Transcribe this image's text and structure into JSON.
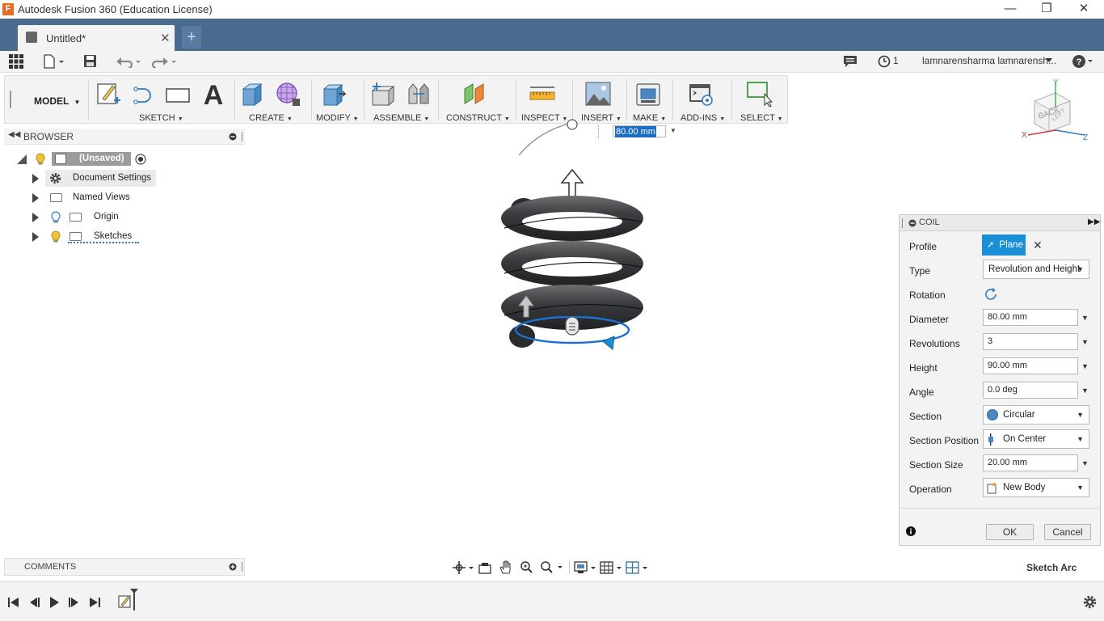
{
  "window": {
    "title": "Autodesk Fusion 360 (Education License)",
    "logo_letter": "F",
    "minimize": "—",
    "maximize": "❐",
    "close": "✕"
  },
  "tabs": [
    {
      "title": "Untitled*",
      "close": "✕"
    }
  ],
  "new_tab": "+",
  "quickbar": {
    "job_count": "1",
    "user": "lamnarensharma lamnarensh...",
    "help": "?"
  },
  "toolbar": {
    "workspace": "MODEL",
    "groups": [
      "SKETCH",
      "CREATE",
      "MODIFY",
      "ASSEMBLE",
      "CONSTRUCT",
      "INSPECT",
      "INSERT",
      "MAKE",
      "ADD-INS",
      "SELECT"
    ]
  },
  "browser": {
    "title": "BROWSER",
    "root": "(Unsaved)",
    "items": [
      "Document Settings",
      "Named Views",
      "Origin",
      "Sketches"
    ]
  },
  "viewport": {
    "dimension_value": "80.00 mm",
    "viewcube_faces": [
      "BACK",
      "LEFT"
    ],
    "axes": [
      "X",
      "Y",
      "Z"
    ]
  },
  "coil": {
    "title": "COIL",
    "profile_label": "Profile",
    "profile_value": "Plane",
    "type_label": "Type",
    "type_value": "Revolution and Height",
    "rotation_label": "Rotation",
    "diameter_label": "Diameter",
    "diameter_value": "80.00 mm",
    "revolutions_label": "Revolutions",
    "revolutions_value": "3",
    "height_label": "Height",
    "height_value": "90.00 mm",
    "angle_label": "Angle",
    "angle_value": "0.0 deg",
    "section_label": "Section",
    "section_value": "Circular",
    "section_position_label": "Section Position",
    "section_position_value": "On Center",
    "section_size_label": "Section Size",
    "section_size_value": "20.00 mm",
    "operation_label": "Operation",
    "operation_value": "New Body",
    "ok": "OK",
    "cancel": "Cancel",
    "accent": "#1a8fd6"
  },
  "comments": {
    "title": "COMMENTS"
  },
  "status": {
    "text": "Sketch Arc"
  }
}
